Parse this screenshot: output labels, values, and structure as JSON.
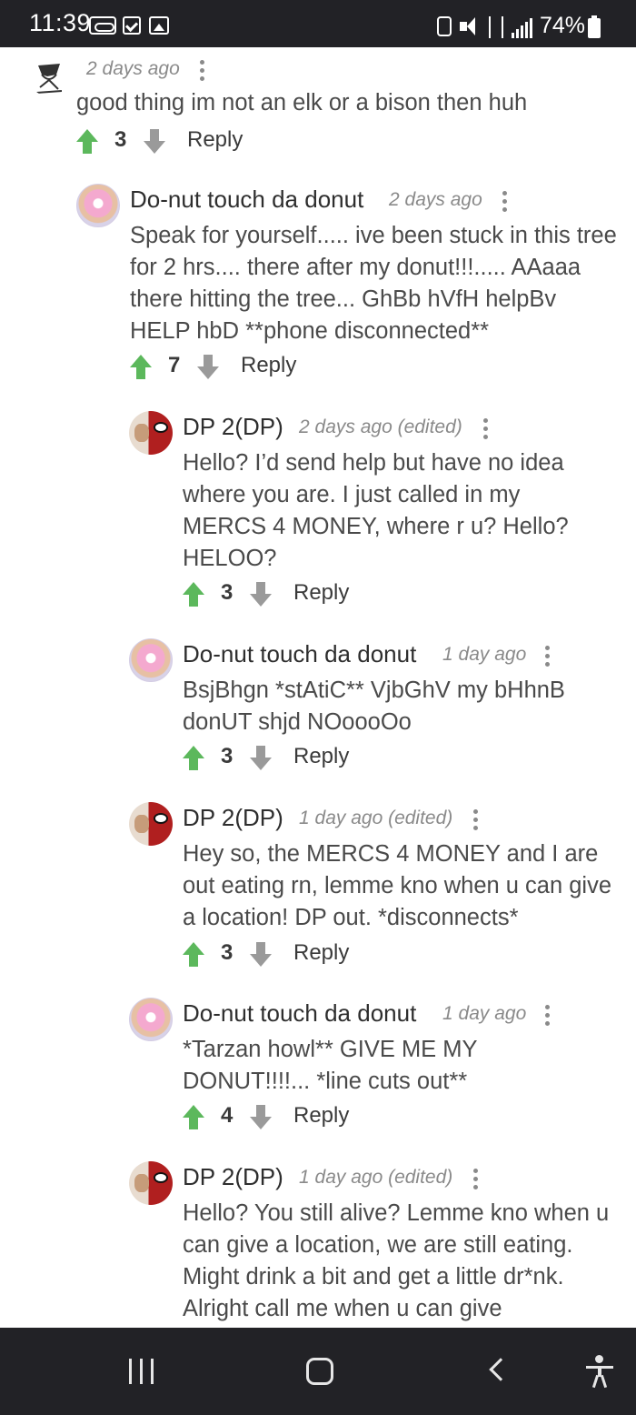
{
  "status_bar": {
    "time": "11:39",
    "battery": "74%",
    "icons": [
      "voicemail-icon",
      "checkbox-icon",
      "gallery-icon",
      "alarm-icon",
      "mute-icon",
      "data-icon",
      "signal-icon",
      "battery-icon"
    ]
  },
  "comments": [
    {
      "author": "",
      "meta": "2 days ago",
      "avatar": "sketch-avatar",
      "body": "good thing im not an elk or a bison then huh",
      "votes": "3",
      "reply": "Reply"
    },
    {
      "author": "Do-nut touch da donut",
      "meta": "2 days ago",
      "avatar": "donut-avatar",
      "body": "Speak for yourself..... ive been stuck in this tree for 2 hrs.... there after my donut!!!..... AAaaa there hitting the tree... GhBb hVfH helpBv HELP hbD **phone disconnected**",
      "votes": "7",
      "reply": "Reply"
    },
    {
      "author": "DP 2(DP)",
      "meta": "2 days ago (edited)",
      "avatar": "deadpool-avatar",
      "body": "Hello? I’d send help but have no idea where you are. I just called in my MERCS 4 MONEY, where r u? Hello? HELOO?",
      "votes": "3",
      "reply": "Reply"
    },
    {
      "author": "Do-nut touch da donut",
      "meta": "1 day ago",
      "avatar": "donut-avatar",
      "body": "BsjBhgn *stAtiC** VjbGhV my bHhnB donUT shjd NOoooOo",
      "votes": "3",
      "reply": "Reply"
    },
    {
      "author": "DP 2(DP)",
      "meta": "1 day ago (edited)",
      "avatar": "deadpool-avatar",
      "body": "Hey so, the MERCS 4 MONEY and I are out eating rn, lemme kno when u can give a location! DP out. *disconnects*",
      "votes": "3",
      "reply": "Reply"
    },
    {
      "author": "Do-nut touch da donut",
      "meta": "1 day ago",
      "avatar": "donut-avatar",
      "body": "*Tarzan howl** GIVE ME MY DONUT!!!!... *line cuts out**",
      "votes": "4",
      "reply": "Reply"
    },
    {
      "author": "DP 2(DP)",
      "meta": "1 day ago (edited)",
      "avatar": "deadpool-avatar",
      "body": "Hello? You still alive? Lemme kno when u can give a location, we are still eating. Might drink a bit and get a little dr*nk. Alright call me when u can give",
      "votes": "",
      "reply": ""
    }
  ],
  "nav_bar": {
    "icons": [
      "recent-apps-icon",
      "home-icon",
      "back-icon",
      "accessibility-icon"
    ]
  },
  "colors": {
    "upvote": "#5cb85c",
    "downvote": "#9a9a9a",
    "bars": "#222226"
  }
}
